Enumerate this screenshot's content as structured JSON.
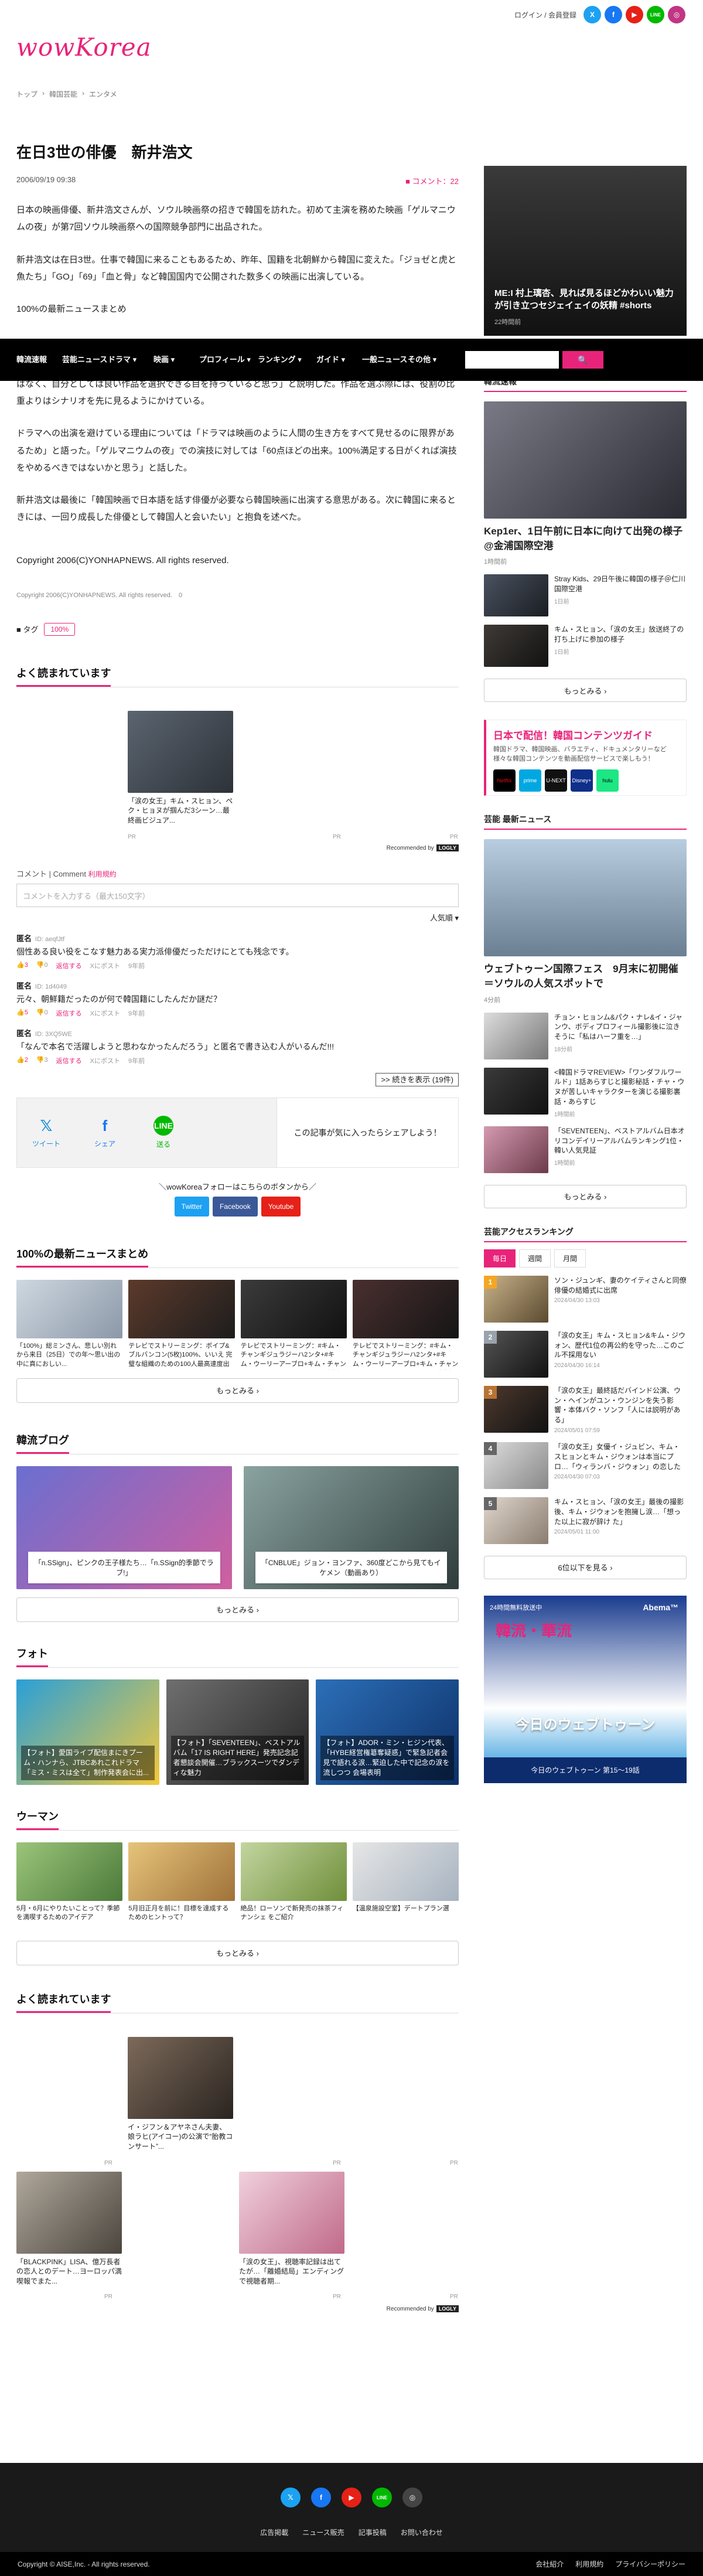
{
  "header": {
    "logo": "wowKorea",
    "login": "ログイン",
    "register": "会員登録",
    "sns": [
      "X",
      "f",
      "▶",
      "LINE",
      "◎"
    ]
  },
  "breadcrumb": [
    "トップ",
    "›",
    "韓国芸能",
    "›",
    "エンタメ"
  ],
  "nav": {
    "items": [
      "韓流速報",
      "芸能ニュース",
      "ドラマ ▾",
      "映画 ▾",
      "プロフィール ▾",
      "ランキング ▾",
      "ガイド ▾",
      "一般ニュース",
      "その他 ▾"
    ],
    "search_icon": "🔍"
  },
  "article": {
    "title": "在日3世の俳優　新井浩文",
    "date": "2006/09/19 09:38",
    "comment_count": "コメント：22",
    "paragraphs": [
      "日本の映画俳優、新井浩文さんが、ソウル映画祭の招きで韓国を訪れた。初めて主演を務めた映画「ゲルマニウムの夜」が第7回ソウル映画祭への国際競争部門に出品された。",
      "新井浩文は在日3世。仕事で韓国に来ることもあるため、昨年、国籍を北朝鮮から韓国に変えた。「ジョゼと虎と魚たち」「GO」「69」「血と骨」など韓国国内で公開された数多くの映画に出演している。"
    ],
    "link_text": "100%の最新ニュースまとめ",
    "paragraphs2": [
      "「人間の内面と暗い部分に関心があり、暗いキャラクター自体は嫌いではない」と話す。いつでも違ったイメージに変えることができ、大きな心配はしていないという。自信の表れかとの問いかけには「演技に対する自信ではなく、自分としては良い作品を選択できる目を持っていると思う」と説明した。作品を選ぶ際には、役割の比重よりはシナリオを先に見るようにかけている。",
      "ドラマへの出演を避けている理由については「ドラマは映画のように人間の生き方をすべて見せるのに限界があるため」と語った。「ゲルマニウムの夜」での演技に対しては「60点ほどの出来。100%満足する日がくれば演技をやめるべきではないかと思う」と話した。",
      "新井浩文は最後に「韓国映画で日本語を話す俳優が必要なら韓国映画に出演する意思がある。次に韓国に来るときには、一回り成長した俳優として韓国人と会いたい」と抱負を述べた。"
    ],
    "copyright_big": "Copyright 2006(C)YONHAPNEWS. All rights reserved.",
    "copyright_small": "Copyright 2006(C)YONHAPNEWS. All rights reserved.",
    "copyright_small_num": "0",
    "tag_label": "タグ",
    "tag": "100%"
  },
  "reco": {
    "title": "よく読まれています",
    "card_caption": "「涙の女王」キム・スヒョン、ペク・ヒョヌが掴んだ3シーン…最終画ビジュア...",
    "pr": "PR",
    "by": "Recommended by",
    "by_brand": "LOGLY"
  },
  "comments": {
    "head": "コメント | Comment",
    "head_link": "利用規約",
    "placeholder": "コメントを入力する（最大150文字）",
    "sort": "人気順 ▾",
    "items": [
      {
        "name": "匿名",
        "id": "ID: aeqfJtf",
        "text": "個性ある良い役をこなす魅力ある実力派俳優だっただけにとても残念です。",
        "good": "👍3",
        "bad": "👎0",
        "reply": "返信する",
        "x": "Xにポスト",
        "ago": "9年前"
      },
      {
        "name": "匿名",
        "id": "ID: 1d4049",
        "text": "元々、朝鮮籍だったのが何で韓国籍にしたんだか謎だ？",
        "good": "👍5",
        "bad": "👎0",
        "reply": "返信する",
        "x": "Xにポスト",
        "ago": "9年前"
      },
      {
        "name": "匿名",
        "id": "ID: 3XQ5WE",
        "text": "「なんで本名で活躍しようと思わなかったんだろう」と匿名で書き込む人がいるんだ!!!",
        "good": "👍2",
        "bad": "👎3",
        "reply": "返信する",
        "x": "Xにポスト",
        "ago": "9年前"
      }
    ],
    "more": ">> 続きを表示 (19件)"
  },
  "share": {
    "items": [
      {
        "icon": "𝕏",
        "label": "ツイート"
      },
      {
        "icon": "f",
        "label": "シェア"
      },
      {
        "icon": "LINE",
        "label": "送る"
      }
    ],
    "msg": "この記事が気に入ったらシェアしよう！"
  },
  "follow": {
    "label": "＼wowKoreaフォローはこちらのボタンから／",
    "buttons": [
      "Twitter",
      "Facebook",
      "Youtube"
    ]
  },
  "news_matome": {
    "title": "100%の最新ニュースまとめ",
    "items": [
      "「100%」総ミンさん、悲しい別れから来日（25日）での年〜思い出の中に真におしい...",
      "テレビでストリーミング：ボイプ&ブルバンコン(5枚)100%、いいえ 完璧な組織のための100人最高速度出展会(カップルマッチングテーマ）（カップル)",
      "テレビでストリーミング：#キム・チャンギジュラジーハ2ンタ+#キム・ウーリーアーブロ+キム・チャンギジュラジーハ2ンタ+EP.08 遊戯部",
      "テレビでストリーミング：#キム・チャンギジュラジーハ2ンタ+#キム・ウーリーアーブロ+キム・チャンギジュラジーハ2ンタ+EP.08 遊戯部"
    ],
    "more": "もっとみる ›"
  },
  "blog": {
    "title": "韓流ブログ",
    "items": [
      "「n.SSign」、ピンクの王子様たち…「n.SSign的季節でラブ!」",
      "「CNBLUE」ジョン・ヨンファ、360度どこから見てもイケメン（動画あり）"
    ],
    "more": "もっとみる ›"
  },
  "photo": {
    "title": "フォト",
    "items": [
      "【フォト】愛国ライブ配信まにきプーム・ハンナら、JTBCあれこれドラマ「ミス・ミスは全て」制作発表会に出...",
      "【フォト】「SEVENTEEN」、ベストアルバム「17 IS RIGHT HERE」発売記念記者懇談会開催…ブラックスーツでダンディな魅力",
      "【フォト】ADOR・ミン・ヒジン代表、「HYBE経営権簒奪疑惑」で緊急記者会見で語れる涙…緊迫した中で記念の涙を流しつつ 会場表明"
    ]
  },
  "woman": {
    "title": "ウーマン",
    "items": [
      "5月・6月にやりたいことって？季節を満喫するためのアイデア",
      "5月旧正月を前に！目標を達成するためのヒントって？",
      "絶品！ローソンで新発売の抹茶フィナンシェ をご紹介",
      "【温泉施設空室】デートプラン選"
    ],
    "more": "もっとみる ›"
  },
  "foot_reco": {
    "title": "よく読まれています",
    "cards": [
      "イ・ジフン＆アヤネさん夫妻、娘ラヒ(アイコー)の公演で“胎教コンサート”...",
      "「BLACKPINK」LISA、億万長者の恋人とのデート…ヨーロッパ満喫報でまた...",
      "「涙の女王」、視聴率記録は出てたが…「離婚結局」エンディングで視聴者期..."
    ],
    "pr": "PR",
    "by": "Recommended by",
    "by_brand": "LOGLY"
  },
  "sidebar": {
    "video_caption": "ME:I 村上璃杏、見れば見るほどかわいい魅力が引き立つセジェイェイの妖精 #shorts",
    "video_sub": "22時間前",
    "flash_title": "韓流速報",
    "hero_title": "Kep1er、1日午前に日本に向けて出発の様子@金浦国際空港",
    "hero_date": "1時間前",
    "flash_items": [
      {
        "t": "Stray Kids、29日午後に韓国の様子＠仁川国際空港",
        "d": "1日前"
      },
      {
        "t": "キム・スヒョン、「涙の女王」放送終了の打ち上げに参加の様子",
        "d": "1日前"
      }
    ],
    "flash_more": "もっとみる ›",
    "banner_title": "日本で配信！韓国コンテンツガイド",
    "banner_sub": "韓国ドラマ、韓国映画、バラエティ、ドキュメンタリーなど様々な韓国コンテンツを動画配信サービスで楽しもう！",
    "banner_logos": [
      "Netflix",
      "prime",
      "U-NEXT",
      "Disney+",
      "hulu"
    ],
    "ent_title": "芸能 最新ニュース",
    "ent_hero": "ウェブトゥーン国際フェス　9月末に初開催＝ソウルの人気スポットで",
    "ent_date": "4分前",
    "ent_items": [
      {
        "t": "チョン・ヒョンム&パク・ナレ&イ・ジャンウ、ボディプロフィール撮影後に泣きそうに「私はハーフ重を…」",
        "d": "18分前"
      },
      {
        "t": "<韓国ドラマREVIEW>「ワンダフルワールド」1話あらすじと撮影秘話・チャ・ウヌが苦しいキャラクターを演じる撮影裏話・あらすじ",
        "d": "1時間前"
      },
      {
        "t": "「SEVENTEEN」、ベストアルバム日本オリコンデイリーアルバムランキング1位・韓い人気見証",
        "d": "1時間前"
      }
    ],
    "ent_more": "もっとみる ›",
    "rank_title": "芸能アクセスランキング",
    "rank_tabs": [
      "毎日",
      "週間",
      "月間"
    ],
    "rank_items": [
      {
        "n": "1",
        "t": "ソン・ジュンギ、妻のケイティさんと同僚俳優の結婚式に出席",
        "d": "2024/04/30 13:03"
      },
      {
        "n": "2",
        "t": "「涙の女王」キム・スヒョン&キム・ジウォン、歴代1位の再公約を守った…このごル不採用ない",
        "d": "2024/04/30 16:14"
      },
      {
        "n": "3",
        "t": "「涙の女王」最終話だバインド公演、ウン・ヘインがユン・ウンジンを失う影響・本体バク・ソンフ「人には説明がある」",
        "d": "2024/05/01 07:59"
      },
      {
        "n": "4",
        "t": "「涙の女王」女優イ・ジュビン、キム・スヒョンとキム・ジウォンは本当にプロ…「ウィランバ・ジウォン」の恋した",
        "d": "2024/04/30 07:03"
      },
      {
        "n": "5",
        "t": "キム・スヒョン、「涙の女王」最後の撮影後、キム・ジウォンを抱擁し涙…「想った以上に寂が辞け た」",
        "d": "2024/05/01 11:00"
      }
    ],
    "rank_more": "6位以下を見る ›",
    "ad": {
      "top": "24時間無料放送中",
      "brand": "Abema™",
      "big": "韓流・華流",
      "mid": "今日のウェブトゥーン",
      "bot": "今日のウェブトゥーン 第15〜19話"
    }
  },
  "footer": {
    "sns": [
      "𝕏",
      "f",
      "▶",
      "LINE",
      "◎"
    ],
    "links": [
      "広告掲載",
      "ニュース販売",
      "記事投稿",
      "お問い合わせ"
    ],
    "copyright": "Copyright © AISE,Inc. - All rights reserved.",
    "bottom_links": [
      "会社紹介",
      "利用規約",
      "プライバシーポリシー"
    ]
  },
  "colors": {
    "accent": "#e8247a",
    "nav_bg": "#000000",
    "footer_bg": "#1a1a1a"
  }
}
